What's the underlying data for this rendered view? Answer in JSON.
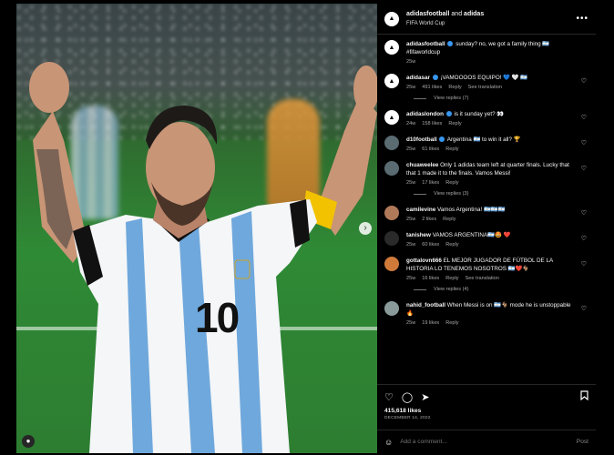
{
  "header": {
    "account": "adidasfootball",
    "and_text": "and",
    "collaborator": "adidas",
    "subtitle": "FIFA World Cup",
    "more_icon": "more-horizontal-icon"
  },
  "caption": {
    "user": "adidasfootball",
    "text": "sunday? no, we got a family thing 🇦🇷 #fifaworldcup",
    "time": "25w"
  },
  "comments": [
    {
      "user": "adidasar",
      "text": "¡VAMOOOOS EQUIPO! 💙 🤍 🇦🇷",
      "time": "25w",
      "likes": "491 likes",
      "reply": "Reply",
      "translate": "See translation",
      "replies": "View replies (7)"
    },
    {
      "user": "adidaslondon",
      "text": "is it sunday yet? 👀",
      "time": "24w",
      "likes": "158 likes",
      "reply": "Reply",
      "translate": "",
      "replies": ""
    },
    {
      "user": "d10football",
      "text": "Argentina 🇦🇷 to win it all? 🏆",
      "time": "25w",
      "likes": "61 likes",
      "reply": "Reply",
      "translate": "",
      "replies": ""
    },
    {
      "user": "chuaweelee",
      "text": "Only 1 adidas team left at quarter finals. Lucky that that 1 made it to the finals. Vamos Messi!",
      "time": "25w",
      "likes": "17 likes",
      "reply": "Reply",
      "translate": "",
      "replies": "View replies (3)"
    },
    {
      "user": "camilevine",
      "text": "Vamos Argentina! 🇦🇷🇦🇷🇦🇷",
      "time": "25w",
      "likes": "2 likes",
      "reply": "Reply",
      "translate": "",
      "replies": ""
    },
    {
      "user": "tanishew",
      "text": "VAMOS ARGENTINA🇦🇷🤩 ❤️",
      "time": "25w",
      "likes": "60 likes",
      "reply": "Reply",
      "translate": "",
      "replies": ""
    },
    {
      "user": "gottalovn666",
      "text": "EL MEJOR JUGADOR DE FÚTBOL DE LA HISTORIA LO TENEMOS NOSOTROS 🇦🇷❤️🐐",
      "time": "25w",
      "likes": "16 likes",
      "reply": "Reply",
      "translate": "See translation",
      "replies": "View replies (4)"
    },
    {
      "user": "nahid_football",
      "text": "When Messi is on 🇦🇷🐐 mode he is unstoppable 🔥",
      "time": "25w",
      "likes": "19 likes",
      "reply": "Reply",
      "translate": "",
      "replies": ""
    }
  ],
  "actions": {
    "likes": "415,618 likes",
    "date": "DECEMBER 14, 2022",
    "icons": [
      "heart-icon",
      "comment-icon",
      "share-icon",
      "bookmark-icon"
    ]
  },
  "composer": {
    "placeholder": "Add a comment...",
    "post_label": "Post",
    "emoji_icon": "emoji-icon"
  },
  "jersey_number": "10"
}
